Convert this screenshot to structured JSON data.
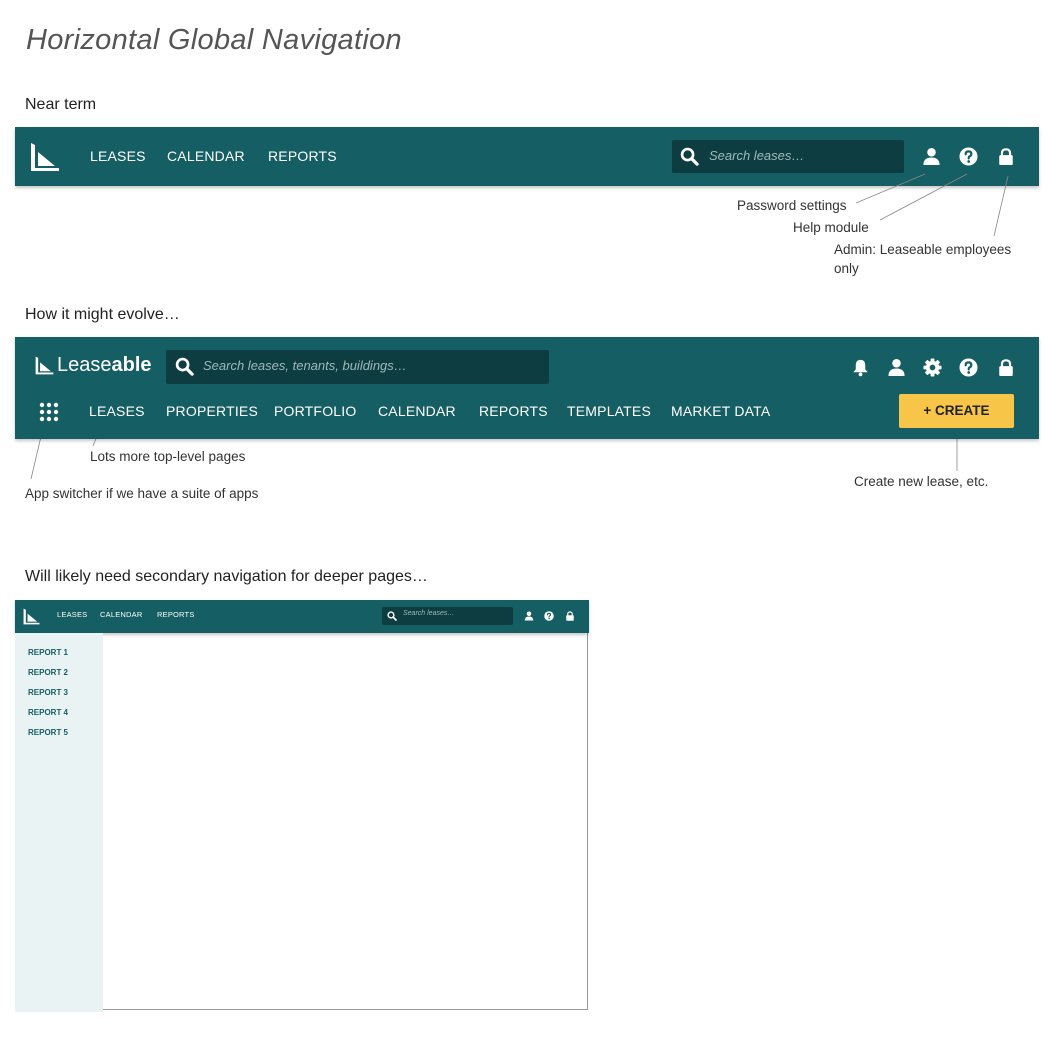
{
  "page_title": "Horizontal Global Navigation",
  "section1": {
    "title": "Near term",
    "nav": {
      "links": [
        "LEASES",
        "CALENDAR",
        "REPORTS"
      ],
      "search_placeholder": "Search leases…"
    },
    "annotations": {
      "password": "Password settings",
      "help": "Help module",
      "admin_line1": "Admin: Leaseable employees",
      "admin_line2": "only"
    }
  },
  "section2": {
    "title": "How it might evolve…",
    "nav": {
      "brand_lease": "Lease",
      "brand_able": "able",
      "search_placeholder": "Search leases, tenants, buildings…",
      "links": [
        "LEASES",
        "PROPERTIES",
        "PORTFOLIO",
        "CALENDAR",
        "REPORTS",
        "TEMPLATES",
        "MARKET DATA"
      ],
      "create_label": "+ CREATE"
    },
    "annotations": {
      "pages": "Lots more top-level pages",
      "app_switcher": "App switcher if we have a suite of apps",
      "create": "Create new lease, etc."
    }
  },
  "section3": {
    "title": "Will likely need secondary navigation for deeper pages…",
    "nav": {
      "links": [
        "LEASES",
        "CALENDAR",
        "REPORTS"
      ],
      "search_placeholder": "Search leases…"
    },
    "sidebar": [
      "REPORT 1",
      "REPORT 2",
      "REPORT 3",
      "REPORT 4",
      "REPORT 5"
    ]
  },
  "colors": {
    "nav_bg": "#155e63",
    "search_bg": "#0d3d40",
    "create_btn": "#f7c548",
    "sidebar_bg": "#eaf3f3"
  }
}
